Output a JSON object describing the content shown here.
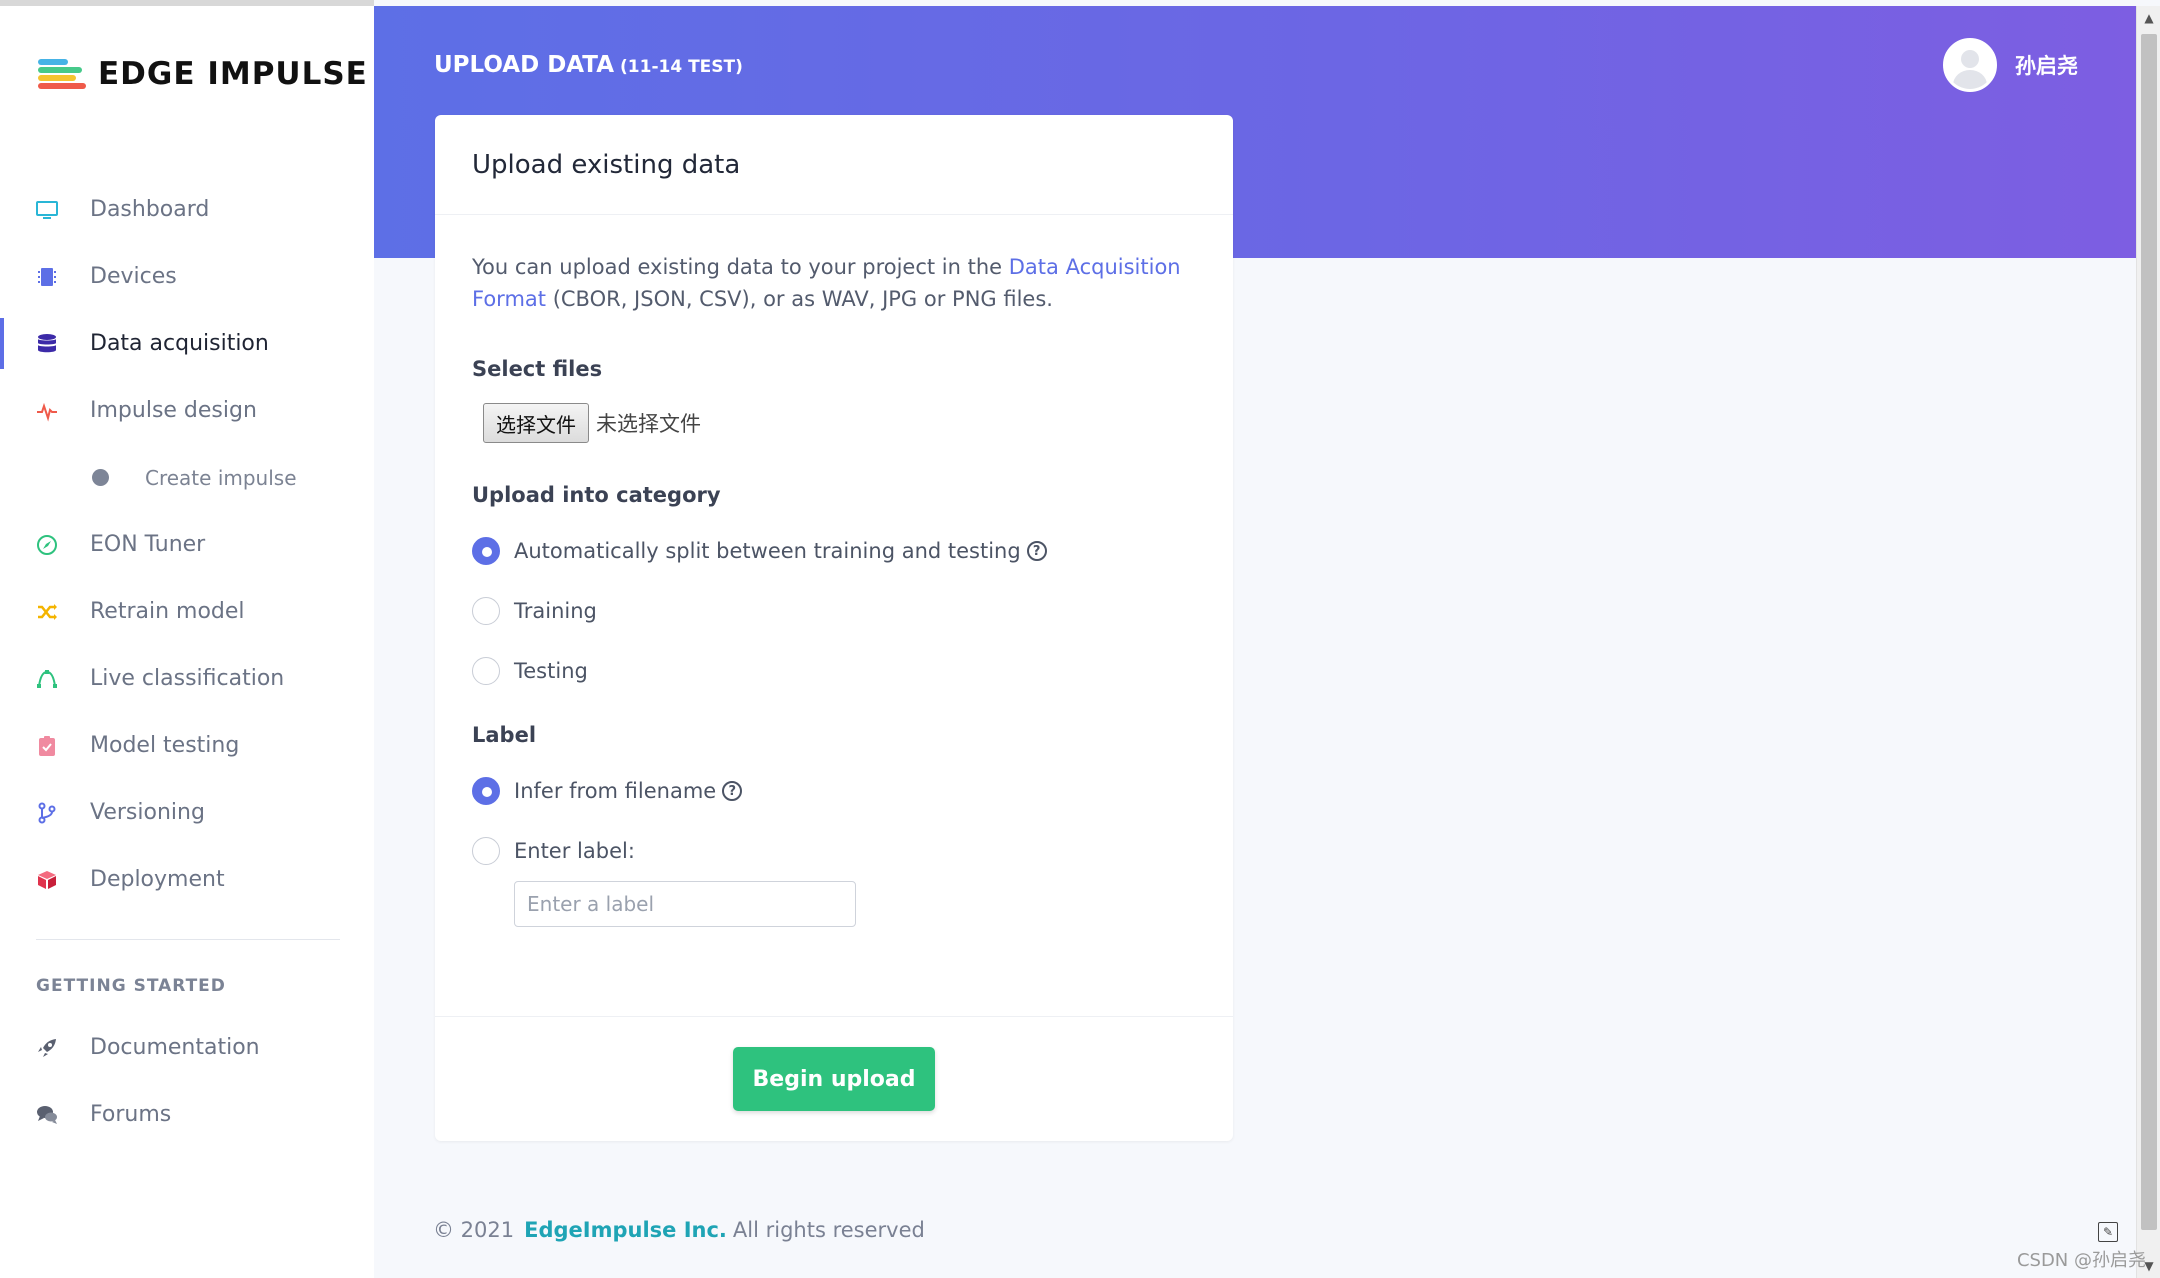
{
  "app": {
    "logo_text": "EDGE IMPULSE"
  },
  "header": {
    "title": "UPLOAD DATA",
    "project": "(11-14 TEST)",
    "user_name": "孙启尧"
  },
  "sidebar": {
    "items": [
      {
        "label": "Dashboard",
        "icon": "monitor-icon"
      },
      {
        "label": "Devices",
        "icon": "chip-icon"
      },
      {
        "label": "Data acquisition",
        "icon": "database-icon",
        "active": true
      },
      {
        "label": "Impulse design",
        "icon": "pulse-icon"
      },
      {
        "label": "Create impulse",
        "icon": "dot-icon",
        "sub": true
      },
      {
        "label": "EON Tuner",
        "icon": "compass-icon"
      },
      {
        "label": "Retrain model",
        "icon": "shuffle-icon"
      },
      {
        "label": "Live classification",
        "icon": "vector-icon"
      },
      {
        "label": "Model testing",
        "icon": "clipboard-check-icon"
      },
      {
        "label": "Versioning",
        "icon": "branch-icon"
      },
      {
        "label": "Deployment",
        "icon": "cube-icon"
      }
    ],
    "section_title": "GETTING STARTED",
    "section_items": [
      {
        "label": "Documentation",
        "icon": "rocket-icon"
      },
      {
        "label": "Forums",
        "icon": "chat-icon"
      }
    ]
  },
  "card": {
    "title": "Upload existing data",
    "desc_prefix": "You can upload existing data to your project in the ",
    "desc_link": "Data Acquisition Format",
    "desc_suffix": " (CBOR, JSON, CSV), or as WAV, JPG or PNG files.",
    "select_files_label": "Select files",
    "file_button": "选择文件",
    "file_none": "未选择文件",
    "category_label": "Upload into category",
    "category_options": [
      "Automatically split between training and testing",
      "Training",
      "Testing"
    ],
    "category_selected": 0,
    "label_title": "Label",
    "label_options": [
      "Infer from filename",
      "Enter label:"
    ],
    "label_selected": 0,
    "label_placeholder": "Enter a label",
    "submit": "Begin upload"
  },
  "footer": {
    "copyright": "© 2021",
    "brand": "EdgeImpulse Inc.",
    "rights": "All rights reserved"
  },
  "watermark": "CSDN @孙启尧",
  "colors": {
    "accent": "#5d6fe6",
    "success": "#2ec27e",
    "brand_link": "#1fa4b5"
  }
}
